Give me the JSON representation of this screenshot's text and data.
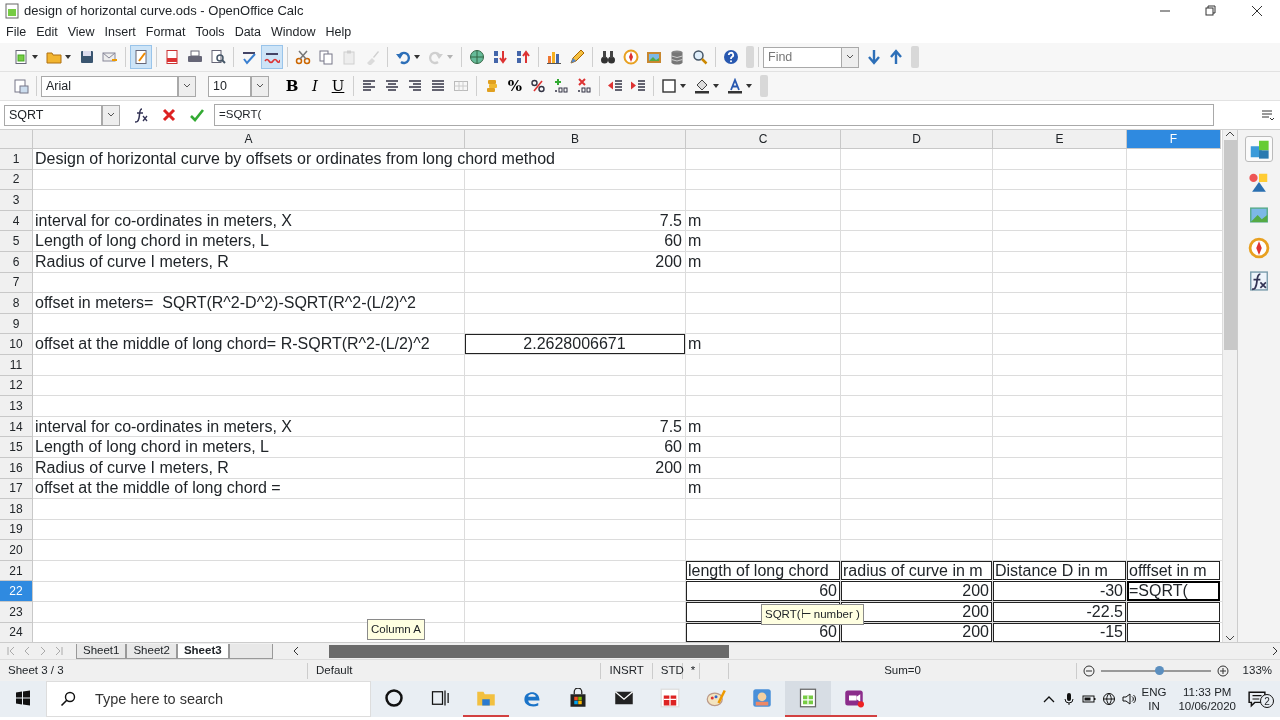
{
  "window": {
    "title": "design of horizontal curve.ods - OpenOffice Calc"
  },
  "menu": [
    "File",
    "Edit",
    "View",
    "Insert",
    "Format",
    "Tools",
    "Data",
    "Window",
    "Help"
  ],
  "standard_toolbar": [
    [
      {
        "kind": "new",
        "on": false,
        "disabled": false,
        "dropdown": true
      },
      {
        "kind": "open",
        "on": false,
        "disabled": false,
        "dropdown": true
      },
      {
        "kind": "save",
        "on": false,
        "disabled": false,
        "dropdown": false
      },
      {
        "kind": "mail",
        "on": false,
        "disabled": false,
        "dropdown": false
      }
    ],
    [
      {
        "kind": "edit",
        "on": true,
        "disabled": false,
        "dropdown": false
      }
    ],
    [
      {
        "kind": "pdf",
        "on": false,
        "disabled": false,
        "dropdown": false
      },
      {
        "kind": "print",
        "on": false,
        "disabled": false,
        "dropdown": false
      },
      {
        "kind": "preview",
        "on": false,
        "disabled": false,
        "dropdown": false
      }
    ],
    [
      {
        "kind": "spell",
        "on": false,
        "disabled": false,
        "dropdown": false
      },
      {
        "kind": "autospell",
        "on": true,
        "disabled": false,
        "dropdown": false
      }
    ],
    [
      {
        "kind": "cut",
        "on": false,
        "disabled": false,
        "dropdown": false
      },
      {
        "kind": "copy",
        "on": false,
        "disabled": false,
        "dropdown": false
      },
      {
        "kind": "paste",
        "on": false,
        "disabled": true,
        "dropdown": false
      },
      {
        "kind": "brush",
        "on": false,
        "disabled": true,
        "dropdown": false
      }
    ],
    [
      {
        "kind": "undo",
        "on": false,
        "disabled": false,
        "dropdown": true
      },
      {
        "kind": "redo",
        "on": false,
        "disabled": true,
        "dropdown": true
      }
    ],
    [
      {
        "kind": "globe",
        "on": false,
        "disabled": false,
        "dropdown": false
      },
      {
        "kind": "sort_asc",
        "on": false,
        "disabled": false,
        "dropdown": false
      },
      {
        "kind": "sort_desc",
        "on": false,
        "disabled": false,
        "dropdown": false
      }
    ],
    [
      {
        "kind": "chart",
        "on": false,
        "disabled": false,
        "dropdown": false
      },
      {
        "kind": "draw",
        "on": false,
        "disabled": false,
        "dropdown": false
      }
    ],
    [
      {
        "kind": "binoculars",
        "on": false,
        "disabled": false,
        "dropdown": false
      },
      {
        "kind": "compass",
        "on": false,
        "disabled": false,
        "dropdown": false
      },
      {
        "kind": "gallery",
        "on": false,
        "disabled": false,
        "dropdown": false
      },
      {
        "kind": "database",
        "on": false,
        "disabled": false,
        "dropdown": false
      },
      {
        "kind": "zoom",
        "on": false,
        "disabled": false,
        "dropdown": false
      }
    ],
    [
      {
        "kind": "help",
        "on": false,
        "disabled": false,
        "dropdown": false
      }
    ]
  ],
  "find": {
    "placeholder": "Find"
  },
  "format_toolbar": {
    "font": "Arial",
    "size": "10",
    "groups": [
      [
        {
          "kind": "bold",
          "label": "B",
          "dropdown": false
        },
        {
          "kind": "italic",
          "label": "I",
          "dropdown": false
        },
        {
          "kind": "underline",
          "label": "U",
          "dropdown": false
        }
      ],
      [
        {
          "kind": "align_left",
          "dropdown": false
        },
        {
          "kind": "align_center",
          "dropdown": false
        },
        {
          "kind": "align_right",
          "dropdown": false
        },
        {
          "kind": "justify",
          "dropdown": false
        },
        {
          "kind": "merge",
          "dropdown": false
        }
      ],
      [
        {
          "kind": "coins",
          "dropdown": false
        },
        {
          "kind": "percent",
          "label": "%",
          "dropdown": false
        },
        {
          "kind": "number_format",
          "dropdown": false
        },
        {
          "kind": "add_decimal",
          "dropdown": false
        },
        {
          "kind": "delete_decimal",
          "dropdown": false
        }
      ],
      [
        {
          "kind": "outdent",
          "dropdown": false
        },
        {
          "kind": "indent",
          "dropdown": false
        }
      ],
      [
        {
          "kind": "borders",
          "dropdown": true
        },
        {
          "kind": "fill",
          "dropdown": true
        },
        {
          "kind": "font_color",
          "dropdown": true
        }
      ]
    ]
  },
  "formula_bar": {
    "name_box": "SQRT",
    "formula": "=SQRT("
  },
  "sheet": {
    "columns": [
      {
        "label": "A",
        "selected": false
      },
      {
        "label": "B",
        "selected": false
      },
      {
        "label": "C",
        "selected": false
      },
      {
        "label": "D",
        "selected": false
      },
      {
        "label": "E",
        "selected": false
      },
      {
        "label": "F",
        "selected": true
      }
    ],
    "rows": [
      {
        "number": "1",
        "selected": false,
        "cells": {
          "A": {
            "text": "Design of horizontal curve by offsets or ordinates from long chord method",
            "kind": "text"
          }
        }
      },
      {
        "number": "2",
        "selected": false,
        "cells": {}
      },
      {
        "number": "3",
        "selected": false,
        "cells": {}
      },
      {
        "number": "4",
        "selected": false,
        "cells": {
          "A": {
            "text": "interval for co-ordinates in meters, X",
            "kind": "text"
          },
          "B": {
            "text": "7.5",
            "kind": "number"
          },
          "C": {
            "text": "m",
            "kind": "text"
          }
        }
      },
      {
        "number": "5",
        "selected": false,
        "cells": {
          "A": {
            "text": "Length of long chord in meters, L",
            "kind": "text"
          },
          "B": {
            "text": "60",
            "kind": "number"
          },
          "C": {
            "text": "m",
            "kind": "text"
          }
        }
      },
      {
        "number": "6",
        "selected": false,
        "cells": {
          "A": {
            "text": "Radius of curve I meters, R",
            "kind": "text"
          },
          "B": {
            "text": "200",
            "kind": "number"
          },
          "C": {
            "text": "m",
            "kind": "text"
          }
        }
      },
      {
        "number": "7",
        "selected": false,
        "cells": {}
      },
      {
        "number": "8",
        "selected": false,
        "cells": {
          "A": {
            "text": "offset in meters=  SQRT(R^2-D^2)-SQRT(R^2-(L/2)^2",
            "kind": "text"
          }
        }
      },
      {
        "number": "9",
        "selected": false,
        "cells": {}
      },
      {
        "number": "10",
        "selected": false,
        "cells": {
          "A": {
            "text": "offset at the middle of long chord= R-SQRT(R^2-(L/2)^2",
            "kind": "text"
          },
          "B": {
            "text": "2.2628006671",
            "kind": "result",
            "boxed": true
          },
          "C": {
            "text": "m",
            "kind": "text"
          }
        }
      },
      {
        "number": "11",
        "selected": false,
        "cells": {}
      },
      {
        "number": "12",
        "selected": false,
        "cells": {}
      },
      {
        "number": "13",
        "selected": false,
        "cells": {}
      },
      {
        "number": "14",
        "selected": false,
        "cells": {
          "A": {
            "text": "interval for co-ordinates in meters, X",
            "kind": "text"
          },
          "B": {
            "text": "7.5",
            "kind": "number"
          },
          "C": {
            "text": "m",
            "kind": "text"
          }
        }
      },
      {
        "number": "15",
        "selected": false,
        "cells": {
          "A": {
            "text": "Length of long chord in meters, L",
            "kind": "text"
          },
          "B": {
            "text": "60",
            "kind": "number"
          },
          "C": {
            "text": "m",
            "kind": "text"
          }
        }
      },
      {
        "number": "16",
        "selected": false,
        "cells": {
          "A": {
            "text": "Radius of curve I meters, R",
            "kind": "text"
          },
          "B": {
            "text": "200",
            "kind": "number"
          },
          "C": {
            "text": "m",
            "kind": "text"
          }
        }
      },
      {
        "number": "17",
        "selected": false,
        "cells": {
          "A": {
            "text": "offset at the middle of long chord =",
            "kind": "text"
          },
          "C": {
            "text": "m",
            "kind": "text"
          }
        }
      },
      {
        "number": "18",
        "selected": false,
        "cells": {}
      },
      {
        "number": "19",
        "selected": false,
        "cells": {}
      },
      {
        "number": "20",
        "selected": false,
        "cells": {}
      },
      {
        "number": "21",
        "selected": false,
        "cells": {
          "C": {
            "text": "length of long chord",
            "kind": "text",
            "boxed": true
          },
          "D": {
            "text": "radius of curve in m",
            "kind": "text",
            "boxed": true
          },
          "E": {
            "text": "Distance D in m",
            "kind": "text",
            "boxed": true
          },
          "F": {
            "text": "offfset in m",
            "kind": "text",
            "boxed": true
          }
        }
      },
      {
        "number": "22",
        "selected": true,
        "cells": {
          "C": {
            "text": "60",
            "kind": "number",
            "boxed": true
          },
          "D": {
            "text": "200",
            "kind": "number",
            "boxed": true
          },
          "E": {
            "text": "-30",
            "kind": "number",
            "boxed": true
          },
          "F": {
            "text": "=SQRT(",
            "kind": "text",
            "boxed": true,
            "active": true
          }
        }
      },
      {
        "number": "23",
        "selected": false,
        "cells": {
          "C": {
            "kind": "number",
            "boxed": true
          },
          "D": {
            "text": "200",
            "kind": "number",
            "boxed": true
          },
          "E": {
            "text": "-22.5",
            "kind": "number",
            "boxed": true
          },
          "F": {
            "kind": "text",
            "boxed": true
          }
        }
      },
      {
        "number": "24",
        "selected": false,
        "cells": {
          "C": {
            "text": "60",
            "kind": "number",
            "boxed": true
          },
          "D": {
            "text": "200",
            "kind": "number",
            "boxed": true
          },
          "E": {
            "text": "-15",
            "kind": "number",
            "boxed": true
          },
          "F": {
            "kind": "text",
            "boxed": true
          }
        }
      }
    ],
    "tooltips": [
      {
        "kind": "column",
        "text": "Column A"
      },
      {
        "kind": "function",
        "text": "SQRT(⊢ number )"
      }
    ]
  },
  "sheet_tabs": [
    {
      "label": "Sheet1",
      "selected": false
    },
    {
      "label": "Sheet2",
      "selected": false
    },
    {
      "label": "Sheet3",
      "selected": true
    }
  ],
  "status_bar": {
    "sheet": "Sheet 3 / 3",
    "page_style": "Default",
    "insert_mode": "INSRT",
    "selection_mode": "STD",
    "modified": "*",
    "sum": "Sum=0",
    "zoom": {
      "level": 0.53
    },
    "zoom_text": "133%"
  },
  "taskbar": {
    "search_placeholder": "Type here to search",
    "apps": [
      {
        "kind": "cortana",
        "running": false,
        "active": false
      },
      {
        "kind": "task_view",
        "running": false,
        "active": false
      },
      {
        "kind": "explorer",
        "running": true,
        "active": false
      },
      {
        "kind": "edge",
        "running": false,
        "active": false
      },
      {
        "kind": "store",
        "running": false,
        "active": false
      },
      {
        "kind": "mail",
        "running": false,
        "active": false
      },
      {
        "kind": "gift",
        "running": false,
        "active": false
      },
      {
        "kind": "paint",
        "running": false,
        "active": false
      },
      {
        "kind": "game",
        "running": false,
        "active": false
      },
      {
        "kind": "calc",
        "running": true,
        "active": true
      },
      {
        "kind": "recorder",
        "running": true,
        "active": false
      }
    ],
    "language": "ENG",
    "region": "IN",
    "time": "11:33 PM",
    "date": "10/06/2020",
    "notifications": "2"
  }
}
